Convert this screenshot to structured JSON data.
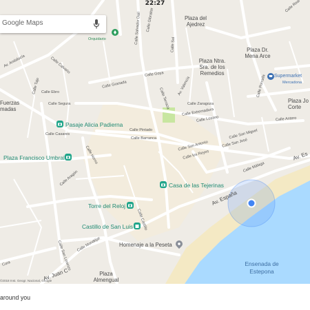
{
  "status_bar": {
    "time": "22:27"
  },
  "search": {
    "placeholder": "Google Maps"
  },
  "map": {
    "streets": [
      "Av. Andalucía",
      "Calle Calvario",
      "Calle Tajo",
      "Calle Ebro",
      "Calle Segura",
      "Calle Granada",
      "Calle Goya",
      "Calle Terraza",
      "Av. Valencia",
      "Calle Zaragoza",
      "Calle Extremadura",
      "Calle Lozano",
      "Calle Pintado",
      "Calle Barranca",
      "Calle Casares",
      "Calle Horno",
      "Calle Aragón",
      "Calle San Antonio",
      "Calle los Reyes",
      "Calle San Miguel",
      "Calle San José",
      "Calle Málaga",
      "Av. España",
      "Av. Es",
      "Calle Antero",
      "Calle Porrada",
      "Calle Sol",
      "Calle Gibraltar",
      "Calle Salvador Dalí",
      "Calle Real",
      "Calle Mondéjar",
      "Calle San Lorenzo",
      "Av. Juan C",
      "Cura",
      "Calle Castillo"
    ],
    "places": {
      "ajedrez": "Plaza del Ajedrez",
      "mena_arce": "Plaza Dr. Mena Arce",
      "remedios": "Plaza Ntra. Sra. de los Remedios",
      "supermarket": "Supermarket",
      "supermarket_sub": "Mercadona",
      "plaza_jose": "Plaza Jo Corte",
      "fuerzas": "Fuerzas madas",
      "plaza": "Pla",
      "orquidario": "Orquidario",
      "alicia": "Pasaje Alicia Padierna",
      "umbral": "Plaza Francisco Umbral",
      "tejerinas": "Casa de las Tejerinas",
      "reloj": "Torre del Reloj",
      "castillo": "Castillo de San Luis",
      "peseta": "Homenaje a la Peseta",
      "almengual": "Plaza Almengual",
      "ensenada": "Ensenada de Estepona"
    },
    "attribution": "©2018 Inst. Geogr. Nacional, Google"
  },
  "footer": {
    "text": "around you"
  },
  "colors": {
    "water": "#aadaff",
    "beach": "#f4e9c4",
    "road": "#ffffff",
    "location_dot": "#4285f4",
    "park": "#c8e6a0"
  }
}
